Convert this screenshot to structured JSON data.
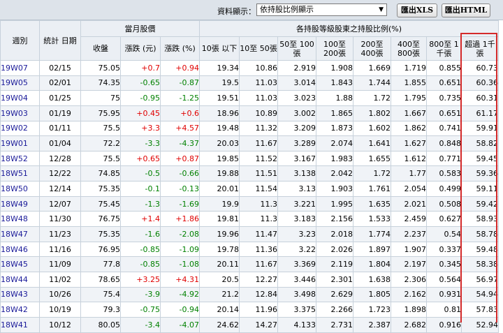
{
  "toolbar": {
    "display_label": "資料顯示：",
    "display_select": "依持股比例顯示",
    "select_arrow": "▼",
    "btn_xls": "匯出XLS",
    "btn_html": "匯出HTML"
  },
  "headers": {
    "week": "週別",
    "stat_date": "統計 日期",
    "monthly_price": "當月股價",
    "close": "收盤",
    "change": "漲跌 (元)",
    "change_pct": "漲跌 (%)",
    "holdings_group": "各持股等級股東之持股比例(%)",
    "h1": "10張 以下",
    "h2": "10至 50張",
    "h3": "50至 100張",
    "h4": "100至 200張",
    "h5": "200至 400張",
    "h6": "400至 800張",
    "h7": "800至 1千張",
    "h8": "超過 1千張"
  },
  "rows": [
    {
      "week": "19W07",
      "date": "02/15",
      "close": "75.05",
      "chg": "+0.7",
      "pct": "+0.94",
      "dir": "up",
      "h": [
        "19.34",
        "10.86",
        "2.919",
        "1.908",
        "1.669",
        "1.719",
        "0.855",
        "60.73"
      ]
    },
    {
      "week": "19W05",
      "date": "02/01",
      "close": "74.35",
      "chg": "-0.65",
      "pct": "-0.87",
      "dir": "dn",
      "h": [
        "19.5",
        "11.03",
        "3.014",
        "1.843",
        "1.744",
        "1.855",
        "0.651",
        "60.36"
      ]
    },
    {
      "week": "19W04",
      "date": "01/25",
      "close": "75",
      "chg": "-0.95",
      "pct": "-1.25",
      "dir": "dn",
      "h": [
        "19.51",
        "11.03",
        "3.023",
        "1.88",
        "1.72",
        "1.795",
        "0.735",
        "60.31"
      ]
    },
    {
      "week": "19W03",
      "date": "01/19",
      "close": "75.95",
      "chg": "+0.45",
      "pct": "+0.6",
      "dir": "up",
      "h": [
        "18.96",
        "10.89",
        "3.002",
        "1.865",
        "1.802",
        "1.667",
        "0.651",
        "61.17"
      ]
    },
    {
      "week": "19W02",
      "date": "01/11",
      "close": "75.5",
      "chg": "+3.3",
      "pct": "+4.57",
      "dir": "up",
      "h": [
        "19.48",
        "11.32",
        "3.209",
        "1.873",
        "1.602",
        "1.862",
        "0.741",
        "59.91"
      ]
    },
    {
      "week": "19W01",
      "date": "01/04",
      "close": "72.2",
      "chg": "-3.3",
      "pct": "-4.37",
      "dir": "dn",
      "h": [
        "20.03",
        "11.67",
        "3.289",
        "2.074",
        "1.641",
        "1.627",
        "0.848",
        "58.82"
      ]
    },
    {
      "week": "18W52",
      "date": "12/28",
      "close": "75.5",
      "chg": "+0.65",
      "pct": "+0.87",
      "dir": "up",
      "h": [
        "19.85",
        "11.52",
        "3.167",
        "1.983",
        "1.655",
        "1.612",
        "0.771",
        "59.45"
      ]
    },
    {
      "week": "18W51",
      "date": "12/22",
      "close": "74.85",
      "chg": "-0.5",
      "pct": "-0.66",
      "dir": "dn",
      "h": [
        "19.88",
        "11.51",
        "3.138",
        "2.042",
        "1.72",
        "1.77",
        "0.583",
        "59.36"
      ]
    },
    {
      "week": "18W50",
      "date": "12/14",
      "close": "75.35",
      "chg": "-0.1",
      "pct": "-0.13",
      "dir": "dn",
      "h": [
        "20.01",
        "11.54",
        "3.13",
        "1.903",
        "1.761",
        "2.054",
        "0.499",
        "59.11"
      ]
    },
    {
      "week": "18W49",
      "date": "12/07",
      "close": "75.45",
      "chg": "-1.3",
      "pct": "-1.69",
      "dir": "dn",
      "h": [
        "19.9",
        "11.3",
        "3.221",
        "1.995",
        "1.635",
        "2.021",
        "0.508",
        "59.42"
      ]
    },
    {
      "week": "18W48",
      "date": "11/30",
      "close": "76.75",
      "chg": "+1.4",
      "pct": "+1.86",
      "dir": "up",
      "h": [
        "19.81",
        "11.3",
        "3.183",
        "2.156",
        "1.533",
        "2.459",
        "0.627",
        "58.93"
      ]
    },
    {
      "week": "18W47",
      "date": "11/23",
      "close": "75.35",
      "chg": "-1.6",
      "pct": "-2.08",
      "dir": "dn",
      "h": [
        "19.96",
        "11.47",
        "3.23",
        "2.018",
        "1.774",
        "2.237",
        "0.54",
        "58.78"
      ]
    },
    {
      "week": "18W46",
      "date": "11/16",
      "close": "76.95",
      "chg": "-0.85",
      "pct": "-1.09",
      "dir": "dn",
      "h": [
        "19.78",
        "11.36",
        "3.22",
        "2.026",
        "1.897",
        "1.907",
        "0.337",
        "59.48"
      ]
    },
    {
      "week": "18W45",
      "date": "11/09",
      "close": "77.8",
      "chg": "-0.85",
      "pct": "-1.08",
      "dir": "dn",
      "h": [
        "20.11",
        "11.67",
        "3.369",
        "2.119",
        "1.804",
        "2.197",
        "0.345",
        "58.38"
      ]
    },
    {
      "week": "18W44",
      "date": "11/02",
      "close": "78.65",
      "chg": "+3.25",
      "pct": "+4.31",
      "dir": "up",
      "h": [
        "20.5",
        "12.27",
        "3.446",
        "2.301",
        "1.638",
        "2.306",
        "0.564",
        "56.97"
      ]
    },
    {
      "week": "18W43",
      "date": "10/26",
      "close": "75.4",
      "chg": "-3.9",
      "pct": "-4.92",
      "dir": "dn",
      "h": [
        "21.2",
        "12.84",
        "3.498",
        "2.629",
        "1.805",
        "2.162",
        "0.931",
        "54.94"
      ]
    },
    {
      "week": "18W42",
      "date": "10/19",
      "close": "79.3",
      "chg": "-0.75",
      "pct": "-0.94",
      "dir": "dn",
      "h": [
        "20.14",
        "11.96",
        "3.375",
        "2.266",
        "1.723",
        "1.898",
        "0.81",
        "57.83"
      ]
    },
    {
      "week": "18W41",
      "date": "10/12",
      "close": "80.05",
      "chg": "-3.4",
      "pct": "-4.07",
      "dir": "dn",
      "h": [
        "24.62",
        "14.27",
        "4.133",
        "2.731",
        "2.387",
        "2.682",
        "0.916",
        "52.94"
      ]
    }
  ]
}
